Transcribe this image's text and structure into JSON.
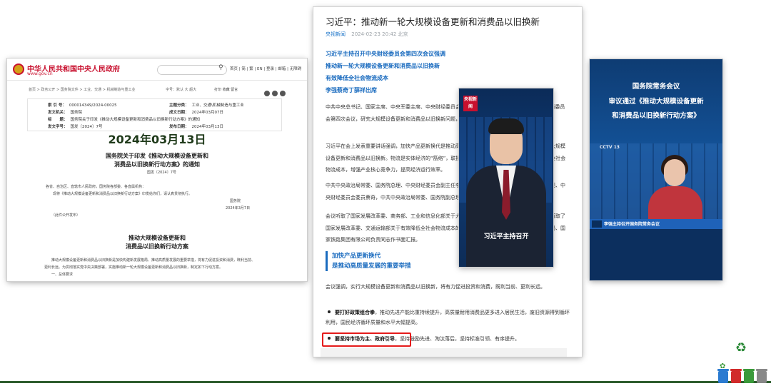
{
  "gov_page": {
    "site_name": "中华人民共和国中央人民政府",
    "domain": "www.gov.cn",
    "header_links": "首页 | 简 | 繁 | EN | 登录 | 邮箱 | 无障碍",
    "breadcrumb": "首页 > 政务公开 > 国务院文件 > 工业、交通 > 机械制造与重工业",
    "font_size": "字号：默认 大 超大",
    "tools": "打印 收藏 留言",
    "meta": {
      "index_label": "索 引 号：",
      "index_value": "000014349/2024-00025",
      "topic_label": "主题分类：",
      "topic_value": "工业、交通\\机械制造与重工业",
      "issuer_label": "发文机关：",
      "issuer_value": "国务院",
      "date_label": "成文日期：",
      "date_value": "2024年03月07日",
      "title_label": "标　　题：",
      "title_value": "国务院关于印发《推动大规模设备更新和消费品以旧换新行动方案》的通知",
      "number_label": "发文字号：",
      "number_value": "国发〔2024〕7号",
      "pub_label": "发布日期：",
      "pub_value": "2024年03月13日"
    },
    "date_overlay": "2024年03月13日",
    "doc_title_1": "国务院关于印发《推动大规模设备更新和",
    "doc_title_2": "消费品以旧换新行动方案》的通知",
    "doc_number": "国发〔2024〕7号",
    "recipients": "各省、自治区、直辖市人民政府，国务院各部委、各直属机构：",
    "body_line": "现将《推动大规模设备更新和消费品以旧换新行动方案》印发给你们，请认真贯彻执行。",
    "signer": "国务院",
    "sign_date": "2024年3月7日",
    "public_note": "（此件公开发布）",
    "plan_title_1": "推动大规模设备更新和",
    "plan_title_2": "消费品以旧换新行动方案",
    "plan_intro_1": "推动大规模设备更新和消费品以旧换新是加快构建新发展格局、推动高质量发展的重要举措，将有力促进投资和消费，既利当前、",
    "plan_intro_2": "更利长远。为贯彻落实党中央决策部署，实施推动新一轮大规模设备更新和消费品以旧换新，制定如下行动方案。",
    "plan_section": "一、总体要求"
  },
  "news": {
    "title": "习近平：推动新一轮大规模设备更新和消费品以旧换新",
    "source": "央视新闻",
    "timestamp": "2024-02-23 20:42  北京",
    "headlines": [
      "习近平主持召开中央财经委员会第四次会议强调",
      "推动新一轮大规模设备更新和消费品以旧换新",
      "有效降低全社会物流成本",
      "李强蔡奇丁薛祥出席"
    ],
    "paragraphs": [
      "中共中央总书记、国家主席、中央军委主席、中央财经委员会主任习近平2月23日下午主持召开中央财经委员会第四次会议，研究大规模设备更新和消费品以旧换新问题，研究有效降低全社会物流成本问题。",
      "习近平在会上发表重要讲话强调，加快产品更新换代是推动高质量发展的重要举措，要鼓励引导新一轮大规模设备更新和消费品以旧换新。物流是实体经济的“筋络”，联接生产和消费、内贸和外贸，必须有效降低全社会物流成本，增强产业核心竞争力，提高经济运行效率。",
      "中共中央政治局常委、国务院总理、中央财经委员会副主任李强，中共中央政治局常委、中央书记处书记、中央财经委员会委员蔡奇，中共中央政治局常委、国务院副总理、中央财经委员会委员丁薛祥出席会议。",
      "会议听取了国家发展改革委、商务部、工业和信息化部关于大规模设备更新和消费品以旧换新的汇报，听取了国家发展改革委、交通运输部关于有效降低全社会物流成本的汇报。住房城乡建设部、国家市场监管总局、国家铁路集团有限公司负责同志作书面汇报。"
    ],
    "section_title_1": "加快产品更新换代",
    "section_title_2": "是推动高质量发展的重要举措",
    "para_after_section": "会议强调，实行大规模设备更新和消费品以旧换新，将有力促进投资和消费，既利当前、更利长远。",
    "bullet_1_bold": "要打好政策组合拳",
    "bullet_1_rest": "，推动先进产能比重持续提升，高质量耐用消费品更多进入居民生活，废旧资源得到循环利用，国民经济循环质量和水平大幅提高。",
    "bullet_2_bold": "要坚持市场为主、政府引导",
    "bullet_2_rest": "，坚持鼓励先进、淘汰落后，坚持标准引领、有序提升。"
  },
  "video": {
    "logo": "央视新闻",
    "caption": "习近平主持召开"
  },
  "tv": {
    "line1": "国务院常务会议",
    "line2": "审议通过《推动大规模设备更新",
    "line3": "和消费品以旧换新行动方案》",
    "channel": "CCTV 13",
    "lower_third": "李强主持召开国务院常务会议"
  },
  "colors": {
    "gov_red": "#c8102e",
    "news_blue": "#1a6bbf",
    "highlight_red": "#e51b1b",
    "tv_blue": "#135196",
    "footer_green": "#2e5d2e",
    "bin_colors": [
      "#2b7bd1",
      "#d12b2b",
      "#3a9a3a",
      "#888888"
    ]
  },
  "icons": [
    "national-emblem-icon",
    "search-icon",
    "share-icon",
    "recycle-icon",
    "sprout-icon",
    "trash-bin-icon"
  ]
}
